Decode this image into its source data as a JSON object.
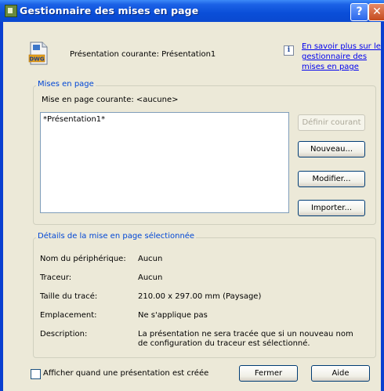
{
  "window": {
    "title": "Gestionnaire des mises en page",
    "help_glyph": "?",
    "close_glyph": "✕"
  },
  "header": {
    "icon": "dwg-file-icon",
    "current_layout": "Présentation courante:  Présentation1",
    "info_icon": "i",
    "learn_more_line1": "En savoir plus sur le",
    "learn_more_line2": "gestionnaire des",
    "learn_more_line3": "mises en page"
  },
  "mises_en_page": {
    "group_title": "Mises en page",
    "current_label": "Mise en page courante:  <aucune>",
    "list_items": [
      "*Présentation1*"
    ],
    "buttons": {
      "set_current": "Définir courant",
      "new": "Nouveau...",
      "modify": "Modifier...",
      "import": "Importer..."
    }
  },
  "details": {
    "group_title": "Détails de la mise en page sélectionnée",
    "rows": [
      {
        "label": "Nom du périphérique:",
        "value": "Aucun"
      },
      {
        "label": "Traceur:",
        "value": "Aucun"
      },
      {
        "label": "Taille du tracé:",
        "value": "210.00 x 297.00 mm (Paysage)"
      },
      {
        "label": "Emplacement:",
        "value": "Ne s'applique pas"
      },
      {
        "label": "Description:",
        "value_line1": "La présentation ne sera tracée que si un nouveau nom",
        "value_line2": "de configuration du traceur est sélectionné."
      }
    ]
  },
  "footer": {
    "checkbox_label": "Afficher quand une présentation est créée",
    "checkbox_checked": false,
    "close_button": "Fermer",
    "help_button": "Aide"
  }
}
